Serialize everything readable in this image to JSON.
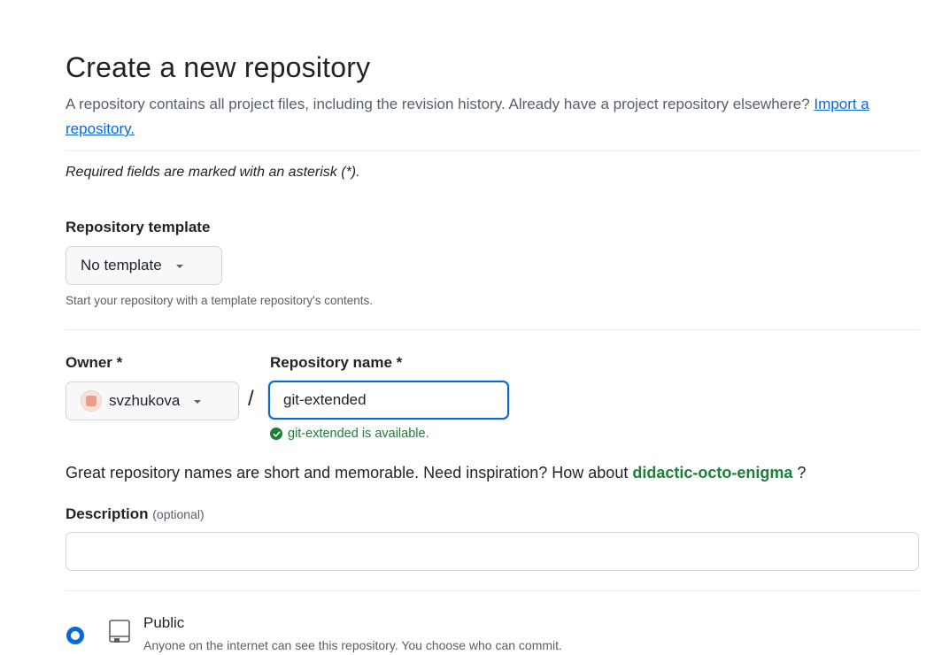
{
  "header": {
    "title": "Create a new repository",
    "subtitle_text": "A repository contains all project files, including the revision history. Already have a project repository elsewhere?",
    "import_link": "Import a repository."
  },
  "required_note": "Required fields are marked with an asterisk (*).",
  "template": {
    "label": "Repository template",
    "selected": "No template",
    "hint": "Start your repository with a template repository's contents."
  },
  "owner": {
    "label": "Owner *",
    "selected": "svzhukova"
  },
  "separator": "/",
  "repo_name": {
    "label": "Repository name *",
    "value": "git-extended",
    "availability": "git-extended is available."
  },
  "inspiration": {
    "text": "Great repository names are short and memorable. Need inspiration? How about",
    "suggestion": "didactic-octo-enigma",
    "suffix": "?"
  },
  "description": {
    "label": "Description",
    "optional": "(optional)",
    "value": ""
  },
  "visibility": {
    "public_label": "Public",
    "public_desc": "Anyone on the internet can see this repository. You choose who can commit."
  },
  "colors": {
    "accent": "#0969da",
    "success": "#1a7f37",
    "muted": "#57606a",
    "border": "#d0d7de"
  }
}
